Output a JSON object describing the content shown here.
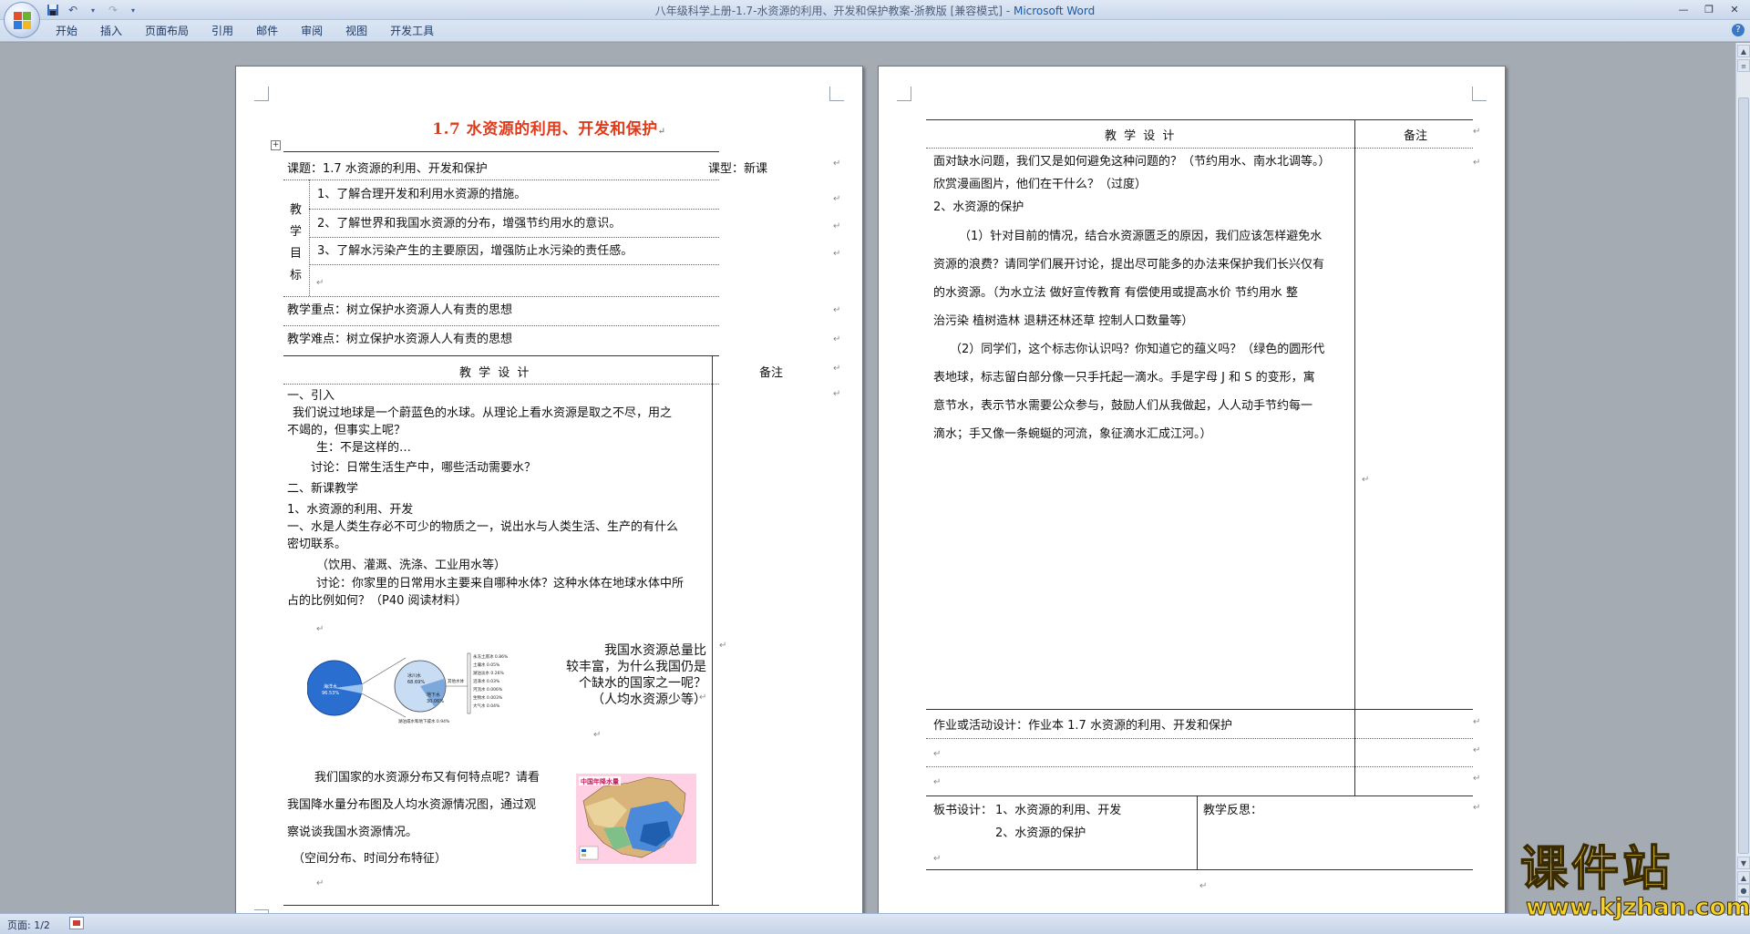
{
  "window": {
    "title": "八年级科学上册-1.7-水资源的利用、开发和保护教案-浙教版 [兼容模式]",
    "app_name": "Microsoft Word",
    "separator": " - "
  },
  "ribbon": {
    "tabs": [
      "开始",
      "插入",
      "页面布局",
      "引用",
      "邮件",
      "审阅",
      "视图",
      "开发工具"
    ]
  },
  "page1": {
    "title": "1.7 水资源的利用、开发和保护",
    "topic_label": "课题：1.7 水资源的利用、开发和保护",
    "lesson_type": "课型：新课",
    "objectives_label": [
      "教",
      "学",
      "目",
      "标"
    ],
    "objectives": [
      "1、了解合理开发和利用水资源的措施。",
      "2、了解世界和我国水资源的分布，增强节约用水的意识。",
      "3、了解水污染产生的主要原因，增强防止水污染的责任感。"
    ],
    "key_point": "教学重点：树立保护水资源人人有责的思想",
    "difficulty": "教学难点：树立保护水资源人人有责的思想",
    "design_header": "教 学 设 计",
    "notes_header": "备注",
    "body": [
      "一、引入",
      "我们说过地球是一个蔚蓝色的水球。从理论上看水资源是取之不尽，用之",
      "不竭的，但事实上呢？",
      "生：不是这样的…",
      "讨论：日常生活生产中，哪些活动需要水？",
      "二、新课教学",
      "1、水资源的利用、开发",
      "一、水是人类生存必不可少的物质之一，说出水与人类生活、生产的有什么",
      "密切联系。",
      "（饮用、灌溉、洗涤、工业用水等）",
      "讨论：你家里的日常用水主要来自哪种水体？这种水体在地球水体中所",
      "占的比例如何？（P40 阅读材料）"
    ],
    "side_question": [
      "我国水资源总量比",
      "较丰富，为什么我国仍是",
      "个缺水的国家之一呢？",
      "（人均水资源少等）"
    ],
    "distribution_text": [
      "我们国家的水资源分布又有何特点呢？请看",
      "我国降水量分布图及人均水资源情况图，通过观",
      "察说谈我国水资源情况。",
      "（空间分布、时间分布特征）"
    ],
    "pie_labels": {
      "ocean": "海洋水",
      "ocean_pct": "96.53%",
      "glacier": "冰川水",
      "glacier_pct": "68.69%",
      "ground": "地下水",
      "ground_pct": "30.06%",
      "lake_salt": "湖泊咸水和地下咸水 0.94%",
      "other": "其他水体",
      "legend": [
        "永冻土底冰 0.86%",
        "土壤水 0.05%",
        "湖泊淡水 0.26%",
        "沼泽水 0.03%",
        "河流水 0.006%",
        "生物水 0.003%",
        "大气水 0.04%"
      ]
    },
    "map_title": "中国年降水量"
  },
  "page2": {
    "design_header": "教 学 设 计",
    "notes_header": "备注",
    "body": [
      "面对缺水问题，我们又是如何避免这种问题的？（节约用水、南水北调等。）",
      "欣赏漫画图片，他们在干什么？（过度）",
      "2、水资源的保护",
      "（1）针对目前的情况，结合水资源匮乏的原因，我们应该怎样避免水",
      "资源的浪费？请同学们展开讨论，提出尽可能多的办法来保护我们长兴仅有",
      "的水资源。（为水立法   做好宣传教育  有偿使用或提高水价  节约用水  整",
      "治污染   植树造林  退耕还林还草   控制人口数量等）",
      "（2）同学们，这个标志你认识吗？你知道它的蕴义吗？（绿色的圆形代",
      "表地球，标志留白部分像一只手托起一滴水。手是字母 J 和 S 的变形，寓",
      "意节水，表示节水需要公众参与，鼓励人们从我做起，人人动手节约每一",
      "滴水；手又像一条蜿蜒的河流，象征滴水汇成江河。）"
    ],
    "homework": "作业或活动设计：作业本 1.7 水资源的利用、开发和保护",
    "board_label": "板书设计：",
    "board_items": [
      "1、水资源的利用、开发",
      "2、水资源的保护"
    ],
    "reflection": "教学反思："
  },
  "status": {
    "page_indicator": "页面: 1/2"
  },
  "watermark": {
    "brand": "课件站",
    "url": "www.kjzhan.com"
  },
  "colors": {
    "title_red": "#e03a1a",
    "ocean_blue": "#2a6fd0",
    "watermark_yellow": "#f5d22a"
  }
}
